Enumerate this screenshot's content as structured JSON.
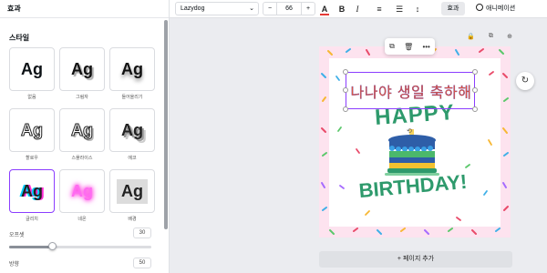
{
  "panel": {
    "header": "효과",
    "section_title": "스타일",
    "styles": [
      {
        "label": "없음",
        "sample": "Ag",
        "class": "ag-none",
        "selected": false
      },
      {
        "label": "그림자",
        "sample": "Ag",
        "class": "ag-shadow",
        "selected": false
      },
      {
        "label": "들어올리기",
        "sample": "Ag",
        "class": "ag-lift",
        "selected": false
      },
      {
        "label": "할로우",
        "sample": "Ag",
        "class": "ag-hollow",
        "selected": false
      },
      {
        "label": "스플라이스",
        "sample": "Ag",
        "class": "ag-splice",
        "selected": false
      },
      {
        "label": "에코",
        "sample": "Ag",
        "class": "ag-echo",
        "selected": false
      },
      {
        "label": "글리치",
        "sample": "Ag",
        "class": "ag-glitch",
        "selected": true
      },
      {
        "label": "네온",
        "sample": "Ag",
        "class": "ag-neon",
        "selected": false
      },
      {
        "label": "배경",
        "sample": "Ag",
        "class": "ag-bg",
        "selected": false
      }
    ],
    "offset": {
      "label": "오프셋",
      "value": "30",
      "fraction": 0.3
    },
    "curve": {
      "label": "방향",
      "value": "50"
    }
  },
  "toolbar": {
    "font": "Lazydog",
    "font_size": "66",
    "minus": "−",
    "plus": "+",
    "color_glyph": "A",
    "bold_glyph": "B",
    "italic_glyph": "I",
    "align_glyph": "≡",
    "list_glyph": "☰",
    "spacing_glyph": "↕",
    "effects": "효과",
    "animate": "애니메이션"
  },
  "canvas": {
    "headline": "나나야 생일 축하해",
    "happy": "HAPPY",
    "birthday": "BIRTHDAY!",
    "add_page": "+ 페이지 추가",
    "colors": {
      "accent": "#8b3dff",
      "page_bg": "#fde3ef",
      "headline": "#e0583e",
      "green": "#2e9a6c"
    }
  }
}
